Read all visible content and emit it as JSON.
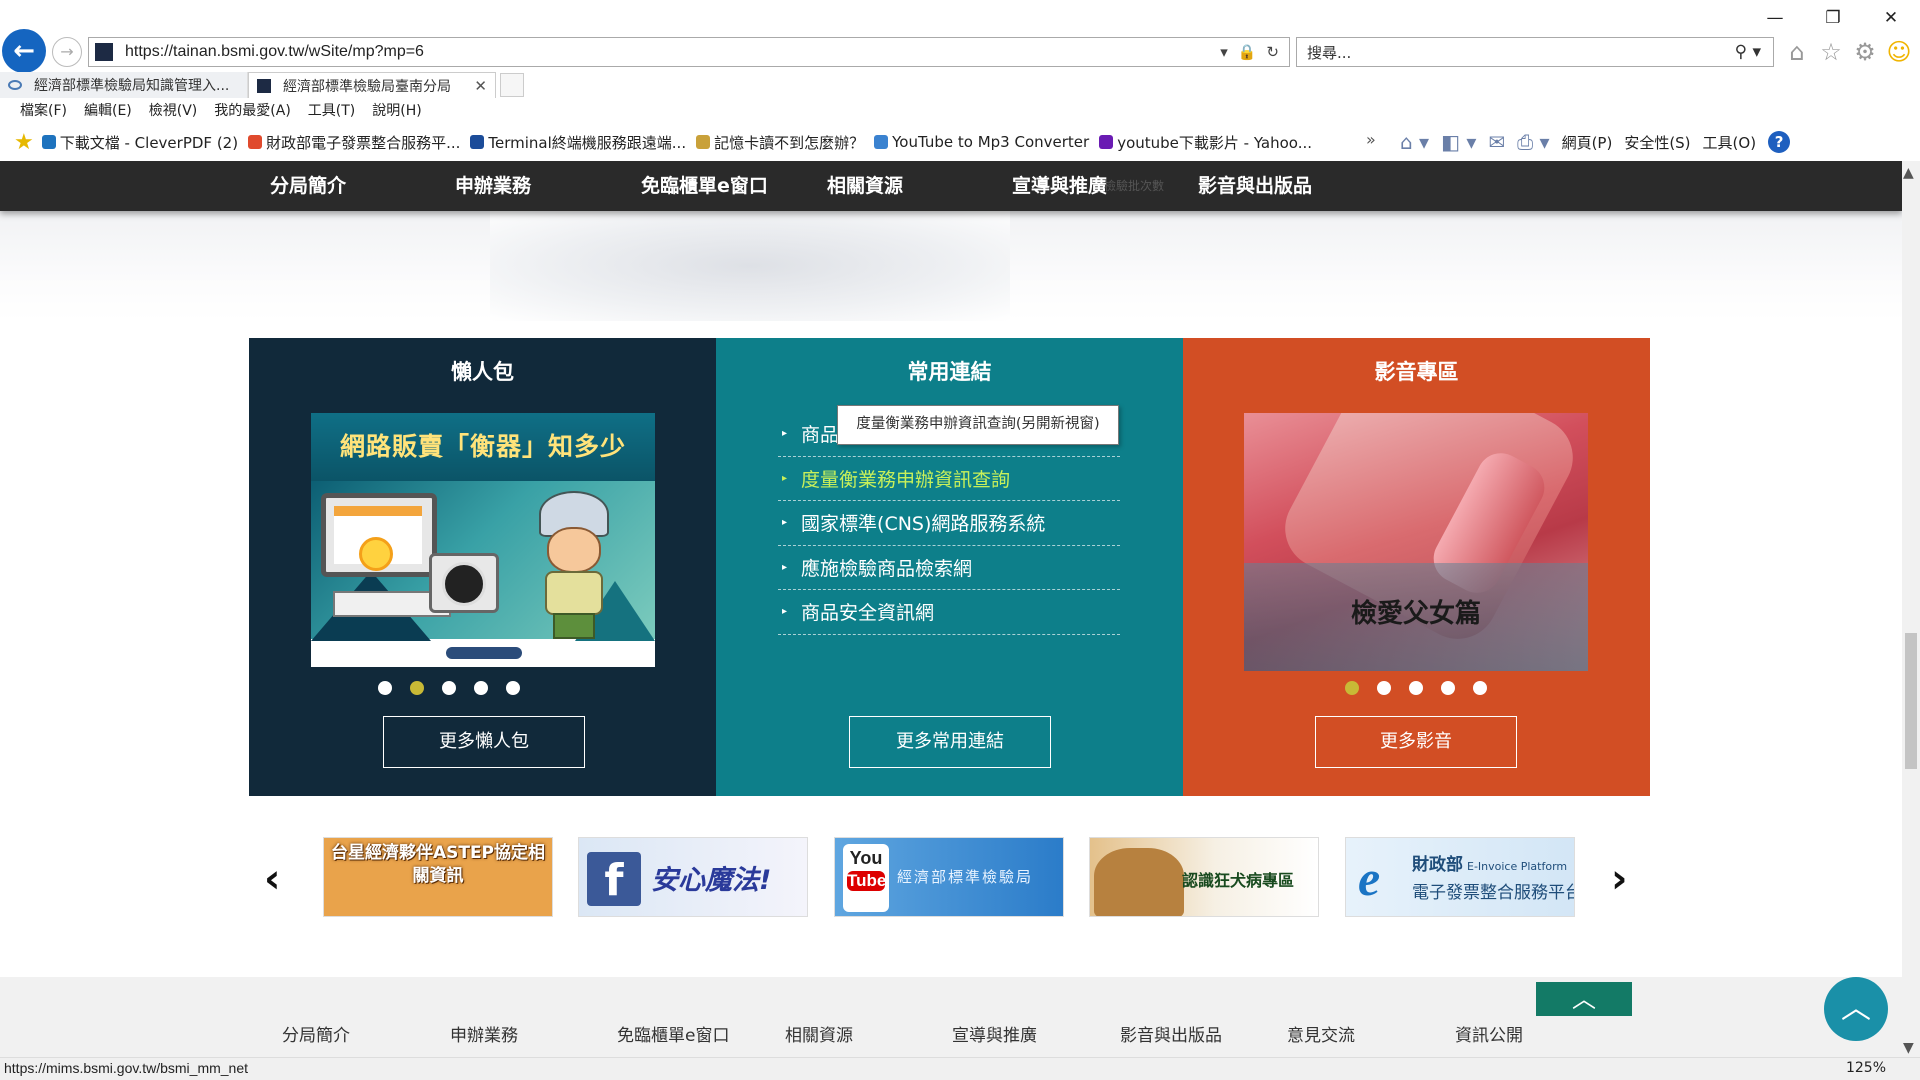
{
  "browser": {
    "url": "https://tainan.bsmi.gov.tw/wSite/mp?mp=6",
    "search_placeholder": "搜尋...",
    "tabs": [
      {
        "label": "經濟部標準檢驗局知識管理入..."
      },
      {
        "label": "經濟部標準檢驗局臺南分局"
      }
    ],
    "menu": [
      "檔案(F)",
      "編輯(E)",
      "檢視(V)",
      "我的最愛(A)",
      "工具(T)",
      "說明(H)"
    ],
    "favorites": [
      {
        "label": "下載文檔 - CleverPDF (2)",
        "color": "#1e73be"
      },
      {
        "label": "財政部電子發票整合服務平...",
        "color": "#e04a2d"
      },
      {
        "label": "Terminal終端機服務跟遠端...",
        "color": "#1c4c99"
      },
      {
        "label": "記憶卡讀不到怎麼辦？",
        "color": "#c9a13a"
      },
      {
        "label": "YouTube to Mp3 Converter",
        "color": "#3a82d0"
      },
      {
        "label": "youtube下載影片 - Yahoo...",
        "color": "#6a1bb3"
      }
    ],
    "command_bar": {
      "page": "網頁(P)",
      "safety": "安全性(S)",
      "tools": "工具(O)"
    },
    "status_url": "https://mims.bsmi.gov.tw/bsmi_mm_net",
    "zoom": "125%"
  },
  "site": {
    "nav": [
      "分局簡介",
      "申辦業務",
      "免臨櫃單e窗口",
      "相關資源",
      "宣導與推廣",
      "影音與出版品"
    ],
    "nav_ghost": "檢驗批次數",
    "panels": {
      "lazy": {
        "title": "懶人包",
        "image_title": "網路販賣「衡器」知多少",
        "more": "更多懶人包",
        "active_dot": 2
      },
      "links": {
        "title": "常用連結",
        "items": [
          "商品安全資訊網",
          "度量衡業務申辦資訊查詢",
          "國家標準(CNS)網路服務系統",
          "應施檢驗商品檢索網",
          "商品安全資訊網"
        ],
        "tooltip": "度量衡業務申辦資訊查詢(另開新視窗)",
        "more": "更多常用連結"
      },
      "video": {
        "title": "影音專區",
        "video_title": "檢愛父女篇",
        "more": "更多影音",
        "active_dot": 1
      }
    },
    "banners": [
      {
        "name": "astep",
        "text": "台星經濟夥伴ASTEP協定相關資訊"
      },
      {
        "name": "facebook",
        "text": "安心魔法!"
      },
      {
        "name": "youtube",
        "text": "經濟部標準檢驗局",
        "you": "You",
        "tube": "Tube"
      },
      {
        "name": "rabies",
        "text": "認識狂犬病專區"
      },
      {
        "name": "einvoice",
        "line1": "財政部",
        "line1_small": "E-Invoice Platform",
        "line2": "電子發票整合服務平台"
      }
    ],
    "footer_nav": [
      "分局簡介",
      "申辦業務",
      "免臨櫃單e窗口",
      "相關資源",
      "宣導與推廣",
      "影音與出版品",
      "意見交流",
      "資訊公開"
    ]
  }
}
